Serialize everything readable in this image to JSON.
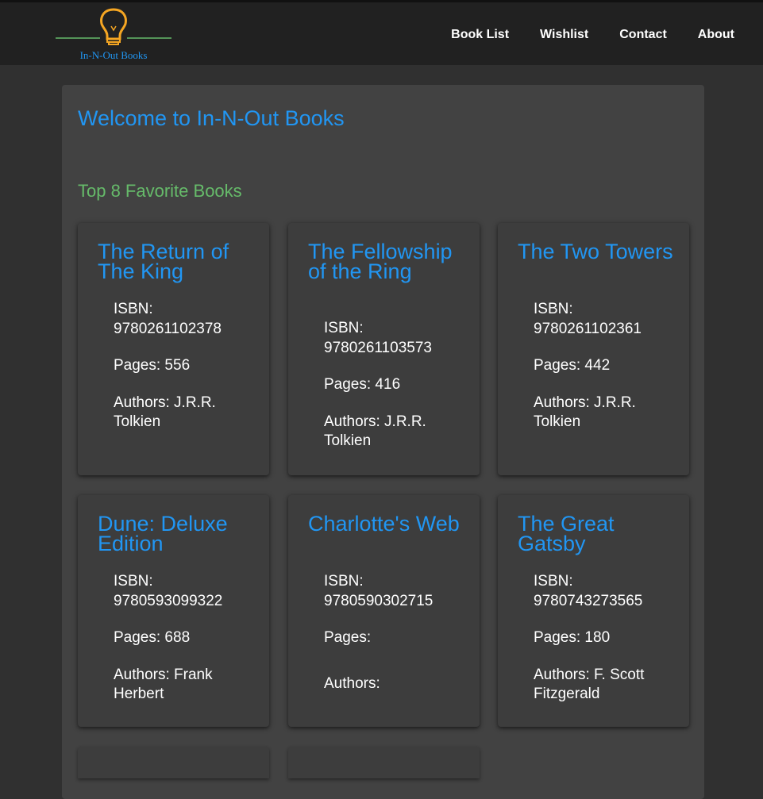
{
  "header": {
    "logo_text": "In-N-Out Books",
    "nav": [
      "Book List",
      "Wishlist",
      "Contact",
      "About"
    ]
  },
  "main": {
    "welcome": "Welcome to In-N-Out Books",
    "subtitle": "Top 8 Favorite Books"
  },
  "books": [
    {
      "title": "The Return of The King",
      "isbn": "ISBN: 9780261102378",
      "pages": "Pages: 556",
      "authors": "Authors: J.R.R. Tolkien"
    },
    {
      "title": "The Fellowship of the Ring",
      "isbn": "ISBN: 9780261103573",
      "pages": "Pages: 416",
      "authors": "Authors: J.R.R. Tolkien"
    },
    {
      "title": "The Two Towers",
      "isbn": "ISBN: 9780261102361",
      "pages": "Pages: 442",
      "authors": "Authors: J.R.R. Tolkien"
    },
    {
      "title": "Dune: Deluxe Edition",
      "isbn": "ISBN: 9780593099322",
      "pages": "Pages: 688",
      "authors": "Authors: Frank Herbert"
    },
    {
      "title": "Charlotte's Web",
      "isbn": "ISBN: 9780590302715",
      "pages": "Pages:",
      "authors": "Authors:"
    },
    {
      "title": "The Great Gatsby",
      "isbn": "ISBN: 9780743273565",
      "pages": "Pages: 180",
      "authors": "Authors: F. Scott Fitzgerald"
    }
  ],
  "colors": {
    "accent": "#2196f3",
    "subtitle": "#66bb6a",
    "logo_bulb": "#f5a623",
    "logo_line": "#66bb6a"
  },
  "icons": {
    "logo": "lightbulb-icon"
  }
}
